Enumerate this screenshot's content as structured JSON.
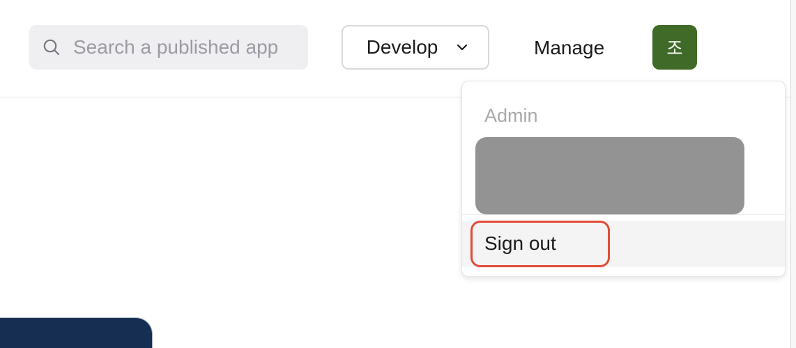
{
  "header": {
    "search": {
      "placeholder": "Search a published app",
      "icon": "search-icon"
    },
    "develop_button": {
      "label": "Develop",
      "icon": "chevron-down-icon"
    },
    "manage_link": {
      "label": "Manage"
    },
    "avatar": {
      "initial": "조",
      "color": "#3f6a27"
    }
  },
  "dropdown": {
    "section_label": "Admin",
    "redacted_block_color": "#939393",
    "sign_out_label": "Sign out",
    "highlight_color": "#e34a35"
  },
  "bottom_card": {
    "color": "#162e52"
  }
}
